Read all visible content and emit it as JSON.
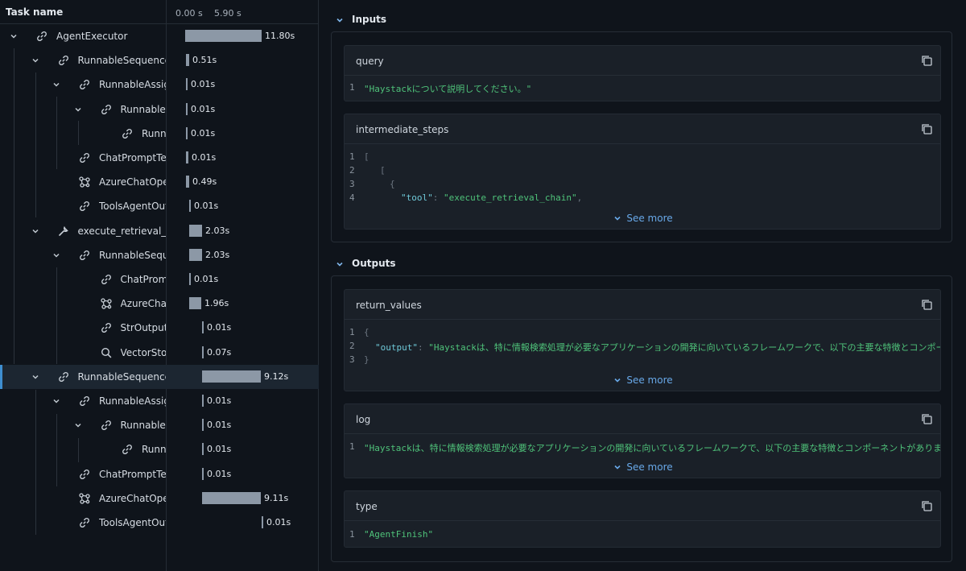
{
  "tree": {
    "header": {
      "task_name": "Task name",
      "tick_0": "0.00 s",
      "tick_1": "5.90 s"
    },
    "rows": [
      {
        "label": "AgentExecutor",
        "icon": "link-icon",
        "duration": "11.80s"
      },
      {
        "label": "RunnableSequence_",
        "icon": "link-icon",
        "duration": "0.51s"
      },
      {
        "label": "RunnableAssign",
        "icon": "link-icon",
        "duration": "0.01s"
      },
      {
        "label": "RunnableP",
        "icon": "link-icon",
        "duration": "0.01s"
      },
      {
        "label": "Runna",
        "icon": "link-icon",
        "duration": "0.01s"
      },
      {
        "label": "ChatPromptTen",
        "icon": "link-icon",
        "duration": "0.01s"
      },
      {
        "label": "AzureChatOper",
        "icon": "model-icon",
        "duration": "0.49s"
      },
      {
        "label": "ToolsAgentOut",
        "icon": "link-icon",
        "duration": "0.01s"
      },
      {
        "label": "execute_retrieval_ch",
        "icon": "wrench-icon",
        "duration": "2.03s"
      },
      {
        "label": "RunnableSeque",
        "icon": "link-icon",
        "duration": "2.03s"
      },
      {
        "label": "ChatPromp",
        "icon": "link-icon",
        "duration": "0.01s"
      },
      {
        "label": "AzureChat",
        "icon": "model-icon",
        "duration": "1.96s"
      },
      {
        "label": "StrOutputI",
        "icon": "link-icon",
        "duration": "0.01s"
      },
      {
        "label": "VectorStor",
        "icon": "search-icon",
        "duration": "0.07s"
      },
      {
        "label": "RunnableSequence_",
        "icon": "link-icon",
        "duration": "9.12s"
      },
      {
        "label": "RunnableAssign",
        "icon": "link-icon",
        "duration": "0.01s"
      },
      {
        "label": "RunnableP",
        "icon": "link-icon",
        "duration": "0.01s"
      },
      {
        "label": "Runna",
        "icon": "link-icon",
        "duration": "0.01s"
      },
      {
        "label": "ChatPromptTen",
        "icon": "link-icon",
        "duration": "0.01s"
      },
      {
        "label": "AzureChatOper",
        "icon": "model-icon",
        "duration": "9.11s"
      },
      {
        "label": "ToolsAgentOut",
        "icon": "link-icon",
        "duration": "0.01s"
      }
    ]
  },
  "inputs": {
    "title": "Inputs",
    "query": {
      "title": "query",
      "line_no": "1",
      "value": "\"Haystackについて説明してください。\""
    },
    "intermediate_steps": {
      "title": "intermediate_steps",
      "lines": [
        {
          "n": "1",
          "text": "["
        },
        {
          "n": "2",
          "text": "["
        },
        {
          "n": "3",
          "text": "{"
        },
        {
          "n": "4",
          "key": "\"tool\"",
          "sep": ": ",
          "value": "\"execute_retrieval_chain\"",
          "end": ","
        }
      ],
      "see_more": "See more"
    }
  },
  "outputs": {
    "title": "Outputs",
    "return_values": {
      "title": "return_values",
      "lines": [
        {
          "n": "1",
          "text": "{"
        },
        {
          "n": "2",
          "key": "\"output\"",
          "sep": ": ",
          "value": "\"Haystackは、特に情報検索処理が必要なアプリケーションの開発に向いているフレームワークで、以下の主要な特徴とコンポーネントがあります。\\"
        },
        {
          "n": "3",
          "text": "}"
        }
      ],
      "see_more": "See more"
    },
    "log": {
      "title": "log",
      "line_no": "1",
      "value": "\"Haystackは、特に情報検索処理が必要なアプリケーションの開発に向いているフレームワークで、以下の主要な特徴とコンポーネントがあります。\\n\\n### 主要な",
      "see_more": "See more"
    },
    "type": {
      "title": "type",
      "line_no": "1",
      "value": "\"AgentFinish\""
    }
  }
}
